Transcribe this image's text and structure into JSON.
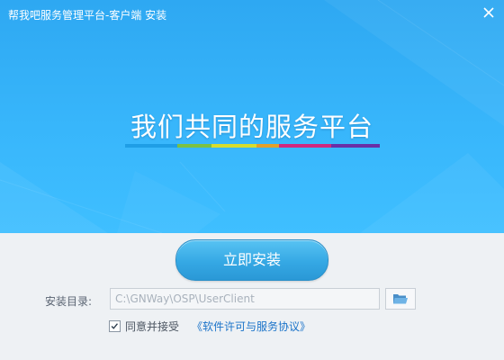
{
  "window": {
    "title": "帮我吧服务管理平台-客户端 安装"
  },
  "banner": {
    "slogan": "我们共同的服务平台",
    "stripe_colors": [
      "#1f9ee6",
      "#7cc142",
      "#d6dd2e",
      "#e2a02a",
      "#d0287f",
      "#6a2fa6"
    ]
  },
  "install": {
    "button_label": "立即安装",
    "dir_label": "安装目录:",
    "dir_value": "C:\\GNWay\\OSP\\UserClient"
  },
  "agreement": {
    "checked": true,
    "agree_label": "同意并接受",
    "link_text": "《软件许可与服务协议》"
  },
  "icons": {
    "close": "close-icon",
    "browse": "folder-icon",
    "check": "check-icon"
  }
}
